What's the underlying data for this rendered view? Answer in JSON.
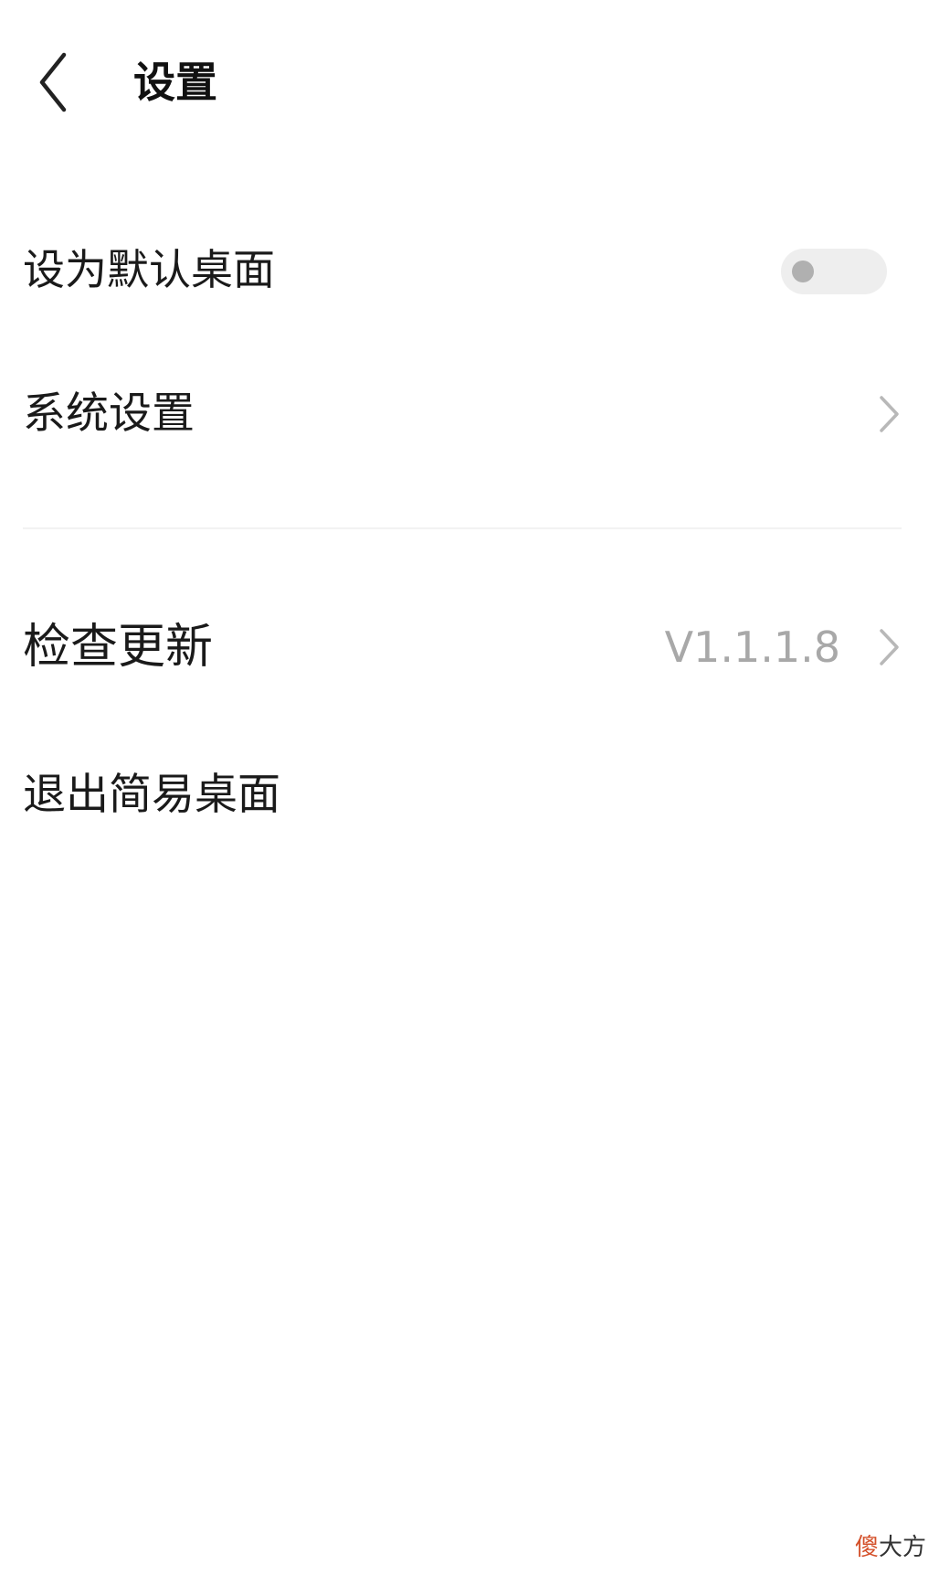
{
  "header": {
    "title": "设置",
    "back_icon": "chevron-left-icon"
  },
  "settings": {
    "default_launcher": {
      "label": "设为默认桌面",
      "toggle_on": false
    },
    "system_settings": {
      "label": "系统设置",
      "chevron_icon": "chevron-right-icon"
    },
    "check_update": {
      "label": "检查更新",
      "version": "V1.1.1.8",
      "chevron_icon": "chevron-right-icon"
    },
    "exit_simple": {
      "label": "退出简易桌面"
    }
  },
  "watermark": {
    "first": "傻",
    "rest": "大方"
  },
  "colors": {
    "background": "#ffffff",
    "text": "#1a1a1a",
    "secondary_text": "#a8a8a8",
    "toggle_track": "#eeeeee",
    "toggle_knob": "#b0b0b0",
    "watermark_accent": "#d4512b"
  }
}
